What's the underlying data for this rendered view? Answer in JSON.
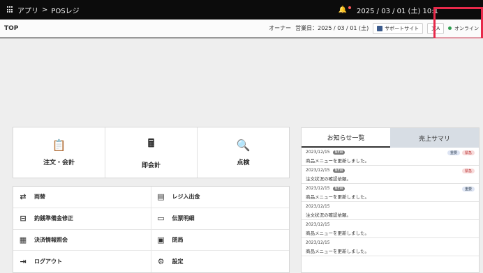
{
  "sysbar": {
    "breadcrumb_app": "アプリ",
    "breadcrumb_sep": ">",
    "breadcrumb_current": "POSレジ",
    "datetime": "2025 / 03 / 01 (土) 10:1",
    "bell_icon": "bell-icon"
  },
  "header": {
    "title": "TOP",
    "owner": "オーナー",
    "business_date": "営業日：2025 / 03 / 01 (土)",
    "support_label": "サポートサイト",
    "translate_label": "文A",
    "online_label": "オンライン",
    "online_color": "#2e9e50"
  },
  "tiles": [
    {
      "icon": "clipboard-edit-icon",
      "glyph": "📋",
      "label": "注文・会計"
    },
    {
      "icon": "register-icon",
      "glyph": "🖩",
      "label": "即会計"
    },
    {
      "icon": "search-check-icon",
      "glyph": "🔍",
      "label": "点検"
    }
  ],
  "menu": [
    {
      "icon": "exchange-icon",
      "glyph": "⇄",
      "label": "両替"
    },
    {
      "icon": "cash-drawer-icon",
      "glyph": "▤",
      "label": "レジ入出金"
    },
    {
      "icon": "clipboard-icon",
      "glyph": "⊟",
      "label": "釣銭準備金修正"
    },
    {
      "icon": "receipt-icon",
      "glyph": "▭",
      "label": "伝票明細"
    },
    {
      "icon": "payment-search-icon",
      "glyph": "▦",
      "label": "決済情報照会"
    },
    {
      "icon": "close-store-icon",
      "glyph": "▣",
      "label": "閉局"
    },
    {
      "icon": "logout-icon",
      "glyph": "⇥",
      "label": "ログアウト"
    },
    {
      "icon": "gear-icon",
      "glyph": "⚙",
      "label": "設定"
    }
  ],
  "news": {
    "tab_active": "お知らせ一覧",
    "tab_inactive": "売上サマリ",
    "items": [
      {
        "date": "2023/12/15",
        "new": "NEW",
        "msg": "商品メニューを更新しました。",
        "tag1": "重要",
        "tag2": "緊急"
      },
      {
        "date": "2023/12/15",
        "new": "NEW",
        "msg": "注文状況の確認依頼。",
        "tag1": "",
        "tag2": "緊急"
      },
      {
        "date": "2023/12/15",
        "new": "NEW",
        "msg": "商品メニューを更新しました。",
        "tag1": "重要",
        "tag2": ""
      },
      {
        "date": "2023/12/15",
        "new": "",
        "msg": "注文状況の確認依頼。",
        "tag1": "",
        "tag2": ""
      },
      {
        "date": "2023/12/15",
        "new": "",
        "msg": "商品メニューを更新しました。",
        "tag1": "",
        "tag2": ""
      },
      {
        "date": "2023/12/15",
        "new": "",
        "msg": "商品メニューを更新しました。",
        "tag1": "",
        "tag2": ""
      }
    ]
  }
}
